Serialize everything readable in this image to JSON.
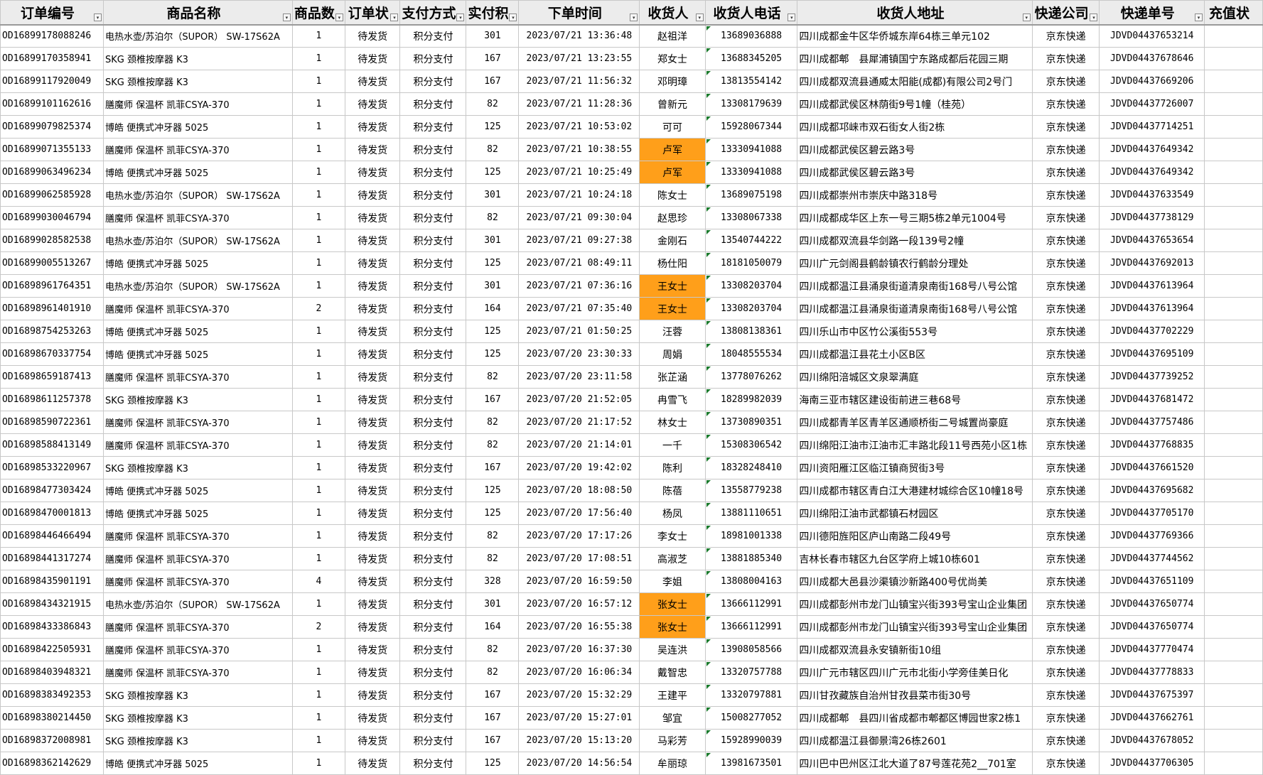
{
  "sheet": {
    "headers": [
      "订单编号",
      "商品名称",
      "商品数",
      "订单状",
      "支付方式",
      "实付积",
      "下单时间",
      "收货人",
      "收货人电话",
      "收货人地址",
      "快递公司",
      "快递单号",
      "充值状"
    ],
    "filter_icon": "▾",
    "highlight_color": "#ff9f1a",
    "rows": [
      {
        "id": "OD16899178088246",
        "name": "电热水壶/苏泊尔（SUPOR） SW-17S62A",
        "qty": "1",
        "status": "待发货",
        "pay": "积分支付",
        "points": "301",
        "time": "2023/07/21 13:36:48",
        "recv": "赵祖洋",
        "phone": "13689036888",
        "addr": "四川成都金牛区华侨城东岸64栋三单元102",
        "co": "京东快递",
        "track": "JDVD04437653214",
        "recharge": "",
        "hl": false
      },
      {
        "id": "OD16899170358941",
        "name": "SKG 颈椎按摩器 K3",
        "qty": "1",
        "status": "待发货",
        "pay": "积分支付",
        "points": "167",
        "time": "2023/07/21 13:23:55",
        "recv": "郑女士",
        "phone": "13688345205",
        "addr": "四川成都郫　县犀浦镇国宁东路成都后花园三期",
        "co": "京东快递",
        "track": "JDVD04437678646",
        "recharge": "",
        "hl": false
      },
      {
        "id": "OD16899117920049",
        "name": "SKG 颈椎按摩器 K3",
        "qty": "1",
        "status": "待发货",
        "pay": "积分支付",
        "points": "167",
        "time": "2023/07/21 11:56:32",
        "recv": "邓明璋",
        "phone": "13813554142",
        "addr": "四川成都双流县通威太阳能(成都)有限公司2号门",
        "co": "京东快递",
        "track": "JDVD04437669206",
        "recharge": "",
        "hl": false
      },
      {
        "id": "OD16899101162616",
        "name": "膳魔师 保温杯 凯菲CSYA-370",
        "qty": "1",
        "status": "待发货",
        "pay": "积分支付",
        "points": "82",
        "time": "2023/07/21 11:28:36",
        "recv": "曾新元",
        "phone": "13308179639",
        "addr": "四川成都武侯区林荫街9号1幢（桂苑）",
        "co": "京东快递",
        "track": "JDVD04437726007",
        "recharge": "",
        "hl": false
      },
      {
        "id": "OD16899079825374",
        "name": "博皓 便携式冲牙器 5025",
        "qty": "1",
        "status": "待发货",
        "pay": "积分支付",
        "points": "125",
        "time": "2023/07/21 10:53:02",
        "recv": "可可",
        "phone": "15928067344",
        "addr": "四川成都邛崃市双石街女人街2栋",
        "co": "京东快递",
        "track": "JDVD04437714251",
        "recharge": "",
        "hl": false
      },
      {
        "id": "OD16899071355133",
        "name": "膳魔师 保温杯 凯菲CSYA-370",
        "qty": "1",
        "status": "待发货",
        "pay": "积分支付",
        "points": "82",
        "time": "2023/07/21 10:38:55",
        "recv": "卢军",
        "phone": "13330941088",
        "addr": "四川成都武侯区碧云路3号",
        "co": "京东快递",
        "track": "JDVD04437649342",
        "recharge": "",
        "hl": true
      },
      {
        "id": "OD16899063496234",
        "name": "博皓 便携式冲牙器 5025",
        "qty": "1",
        "status": "待发货",
        "pay": "积分支付",
        "points": "125",
        "time": "2023/07/21 10:25:49",
        "recv": "卢军",
        "phone": "13330941088",
        "addr": "四川成都武侯区碧云路3号",
        "co": "京东快递",
        "track": "JDVD04437649342",
        "recharge": "",
        "hl": true
      },
      {
        "id": "OD16899062585928",
        "name": "电热水壶/苏泊尔（SUPOR） SW-17S62A",
        "qty": "1",
        "status": "待发货",
        "pay": "积分支付",
        "points": "301",
        "time": "2023/07/21 10:24:18",
        "recv": "陈女士",
        "phone": "13689075198",
        "addr": "四川成都崇州市崇庆中路318号",
        "co": "京东快递",
        "track": "JDVD04437633549",
        "recharge": "",
        "hl": false
      },
      {
        "id": "OD16899030046794",
        "name": "膳魔师 保温杯 凯菲CSYA-370",
        "qty": "1",
        "status": "待发货",
        "pay": "积分支付",
        "points": "82",
        "time": "2023/07/21 09:30:04",
        "recv": "赵思珍",
        "phone": "13308067338",
        "addr": "四川成都成华区上东一号三期5栋2单元1004号",
        "co": "京东快递",
        "track": "JDVD04437738129",
        "recharge": "",
        "hl": false
      },
      {
        "id": "OD16899028582538",
        "name": "电热水壶/苏泊尔（SUPOR） SW-17S62A",
        "qty": "1",
        "status": "待发货",
        "pay": "积分支付",
        "points": "301",
        "time": "2023/07/21 09:27:38",
        "recv": "金刚石",
        "phone": "13540744222",
        "addr": "四川成都双流县华剑路一段139号2幢",
        "co": "京东快递",
        "track": "JDVD04437653654",
        "recharge": "",
        "hl": false
      },
      {
        "id": "OD16899005513267",
        "name": "博皓 便携式冲牙器 5025",
        "qty": "1",
        "status": "待发货",
        "pay": "积分支付",
        "points": "125",
        "time": "2023/07/21 08:49:11",
        "recv": "杨仕阳",
        "phone": "18181050079",
        "addr": "四川广元剑阁县鹤龄镇农行鹤龄分理处",
        "co": "京东快递",
        "track": "JDVD04437692013",
        "recharge": "",
        "hl": false
      },
      {
        "id": "OD16898961764351",
        "name": "电热水壶/苏泊尔（SUPOR） SW-17S62A",
        "qty": "1",
        "status": "待发货",
        "pay": "积分支付",
        "points": "301",
        "time": "2023/07/21 07:36:16",
        "recv": "王女士",
        "phone": "13308203704",
        "addr": "四川成都温江县涌泉街道清泉南街168号八号公馆",
        "co": "京东快递",
        "track": "JDVD04437613964",
        "recharge": "",
        "hl": true
      },
      {
        "id": "OD16898961401910",
        "name": "膳魔师 保温杯 凯菲CSYA-370",
        "qty": "2",
        "status": "待发货",
        "pay": "积分支付",
        "points": "164",
        "time": "2023/07/21 07:35:40",
        "recv": "王女士",
        "phone": "13308203704",
        "addr": "四川成都温江县涌泉街道清泉南街168号八号公馆",
        "co": "京东快递",
        "track": "JDVD04437613964",
        "recharge": "",
        "hl": true
      },
      {
        "id": "OD16898754253263",
        "name": "博皓 便携式冲牙器 5025",
        "qty": "1",
        "status": "待发货",
        "pay": "积分支付",
        "points": "125",
        "time": "2023/07/21 01:50:25",
        "recv": "汪蓉",
        "phone": "13808138361",
        "addr": "四川乐山市中区竹公溪街553号",
        "co": "京东快递",
        "track": "JDVD04437702229",
        "recharge": "",
        "hl": false
      },
      {
        "id": "OD16898670337754",
        "name": "博皓 便携式冲牙器 5025",
        "qty": "1",
        "status": "待发货",
        "pay": "积分支付",
        "points": "125",
        "time": "2023/07/20 23:30:33",
        "recv": "周娟",
        "phone": "18048555534",
        "addr": "四川成都温江县花土小区B区",
        "co": "京东快递",
        "track": "JDVD04437695109",
        "recharge": "",
        "hl": false
      },
      {
        "id": "OD16898659187413",
        "name": "膳魔师 保温杯 凯菲CSYA-370",
        "qty": "1",
        "status": "待发货",
        "pay": "积分支付",
        "points": "82",
        "time": "2023/07/20 23:11:58",
        "recv": "张芷涵",
        "phone": "13778076262",
        "addr": "四川绵阳涪城区文泉翠满庭",
        "co": "京东快递",
        "track": "JDVD04437739252",
        "recharge": "",
        "hl": false
      },
      {
        "id": "OD16898611257378",
        "name": "SKG 颈椎按摩器 K3",
        "qty": "1",
        "status": "待发货",
        "pay": "积分支付",
        "points": "167",
        "time": "2023/07/20 21:52:05",
        "recv": "冉雪飞",
        "phone": "18289982039",
        "addr": "海南三亚市辖区建设街前进三巷68号",
        "co": "京东快递",
        "track": "JDVD04437681472",
        "recharge": "",
        "hl": false
      },
      {
        "id": "OD16898590722361",
        "name": "膳魔师 保温杯 凯菲CSYA-370",
        "qty": "1",
        "status": "待发货",
        "pay": "积分支付",
        "points": "82",
        "time": "2023/07/20 21:17:52",
        "recv": "林女士",
        "phone": "13730890351",
        "addr": "四川成都青羊区青羊区通顺桥街二号城置尚豪庭",
        "co": "京东快递",
        "track": "JDVD04437757486",
        "recharge": "",
        "hl": false
      },
      {
        "id": "OD16898588413149",
        "name": "膳魔师 保温杯 凯菲CSYA-370",
        "qty": "1",
        "status": "待发货",
        "pay": "积分支付",
        "points": "82",
        "time": "2023/07/20 21:14:01",
        "recv": "一千",
        "phone": "15308306542",
        "addr": "四川绵阳江油市江油市汇丰路北段11号西苑小区1栋",
        "co": "京东快递",
        "track": "JDVD04437768835",
        "recharge": "",
        "hl": false
      },
      {
        "id": "OD16898533220967",
        "name": "SKG 颈椎按摩器 K3",
        "qty": "1",
        "status": "待发货",
        "pay": "积分支付",
        "points": "167",
        "time": "2023/07/20 19:42:02",
        "recv": "陈利",
        "phone": "18328248410",
        "addr": "四川资阳雁江区临江镇商贸街3号",
        "co": "京东快递",
        "track": "JDVD04437661520",
        "recharge": "",
        "hl": false
      },
      {
        "id": "OD16898477303424",
        "name": "博皓 便携式冲牙器 5025",
        "qty": "1",
        "status": "待发货",
        "pay": "积分支付",
        "points": "125",
        "time": "2023/07/20 18:08:50",
        "recv": "陈蓓",
        "phone": "13558779238",
        "addr": "四川成都市辖区青白江大港建材城综合区10幢18号",
        "co": "京东快递",
        "track": "JDVD04437695682",
        "recharge": "",
        "hl": false
      },
      {
        "id": "OD16898470001813",
        "name": "博皓 便携式冲牙器 5025",
        "qty": "1",
        "status": "待发货",
        "pay": "积分支付",
        "points": "125",
        "time": "2023/07/20 17:56:40",
        "recv": "杨凤",
        "phone": "13881110651",
        "addr": "四川绵阳江油市武都镇石材园区",
        "co": "京东快递",
        "track": "JDVD04437705170",
        "recharge": "",
        "hl": false
      },
      {
        "id": "OD16898446466494",
        "name": "膳魔师 保温杯 凯菲CSYA-370",
        "qty": "1",
        "status": "待发货",
        "pay": "积分支付",
        "points": "82",
        "time": "2023/07/20 17:17:26",
        "recv": "李女士",
        "phone": "18981001338",
        "addr": "四川德阳旌阳区庐山南路二段49号",
        "co": "京东快递",
        "track": "JDVD04437769366",
        "recharge": "",
        "hl": false
      },
      {
        "id": "OD16898441317274",
        "name": "膳魔师 保温杯 凯菲CSYA-370",
        "qty": "1",
        "status": "待发货",
        "pay": "积分支付",
        "points": "82",
        "time": "2023/07/20 17:08:51",
        "recv": "高淑芝",
        "phone": "13881885340",
        "addr": "吉林长春市辖区九台区学府上城10栋601",
        "co": "京东快递",
        "track": "JDVD04437744562",
        "recharge": "",
        "hl": false
      },
      {
        "id": "OD16898435901191",
        "name": "膳魔师 保温杯 凯菲CSYA-370",
        "qty": "4",
        "status": "待发货",
        "pay": "积分支付",
        "points": "328",
        "time": "2023/07/20 16:59:50",
        "recv": "李姐",
        "phone": "13808004163",
        "addr": "四川成都大邑县沙渠镇沙新路400号优尚美",
        "co": "京东快递",
        "track": "JDVD04437651109",
        "recharge": "",
        "hl": false
      },
      {
        "id": "OD16898434321915",
        "name": "电热水壶/苏泊尔（SUPOR） SW-17S62A",
        "qty": "1",
        "status": "待发货",
        "pay": "积分支付",
        "points": "301",
        "time": "2023/07/20 16:57:12",
        "recv": "张女士",
        "phone": "13666112991",
        "addr": "四川成都彭州市龙门山镇宝兴街393号宝山企业集团",
        "co": "京东快递",
        "track": "JDVD04437650774",
        "recharge": "",
        "hl": true
      },
      {
        "id": "OD16898433386843",
        "name": "膳魔师 保温杯 凯菲CSYA-370",
        "qty": "2",
        "status": "待发货",
        "pay": "积分支付",
        "points": "164",
        "time": "2023/07/20 16:55:38",
        "recv": "张女士",
        "phone": "13666112991",
        "addr": "四川成都彭州市龙门山镇宝兴街393号宝山企业集团",
        "co": "京东快递",
        "track": "JDVD04437650774",
        "recharge": "",
        "hl": true
      },
      {
        "id": "OD16898422505931",
        "name": "膳魔师 保温杯 凯菲CSYA-370",
        "qty": "1",
        "status": "待发货",
        "pay": "积分支付",
        "points": "82",
        "time": "2023/07/20 16:37:30",
        "recv": "吴连洪",
        "phone": "13908058566",
        "addr": "四川成都双流县永安镇新街10组",
        "co": "京东快递",
        "track": "JDVD04437770474",
        "recharge": "",
        "hl": false
      },
      {
        "id": "OD16898403948321",
        "name": "膳魔师 保温杯 凯菲CSYA-370",
        "qty": "1",
        "status": "待发货",
        "pay": "积分支付",
        "points": "82",
        "time": "2023/07/20 16:06:34",
        "recv": "戴智忠",
        "phone": "13320757788",
        "addr": "四川广元市辖区四川广元市北街小学旁佳美日化",
        "co": "京东快递",
        "track": "JDVD04437778833",
        "recharge": "",
        "hl": false
      },
      {
        "id": "OD16898383492353",
        "name": "SKG 颈椎按摩器 K3",
        "qty": "1",
        "status": "待发货",
        "pay": "积分支付",
        "points": "167",
        "time": "2023/07/20 15:32:29",
        "recv": "王建平",
        "phone": "13320797881",
        "addr": "四川甘孜藏族自治州甘孜县菜市街30号",
        "co": "京东快递",
        "track": "JDVD04437675397",
        "recharge": "",
        "hl": false
      },
      {
        "id": "OD16898380214450",
        "name": "SKG 颈椎按摩器 K3",
        "qty": "1",
        "status": "待发货",
        "pay": "积分支付",
        "points": "167",
        "time": "2023/07/20 15:27:01",
        "recv": "邹宜",
        "phone": "15008277052",
        "addr": "四川成都郫　县四川省成都市郫都区博园世家2栋1",
        "co": "京东快递",
        "track": "JDVD04437662761",
        "recharge": "",
        "hl": false
      },
      {
        "id": "OD16898372008981",
        "name": "SKG 颈椎按摩器 K3",
        "qty": "1",
        "status": "待发货",
        "pay": "积分支付",
        "points": "167",
        "time": "2023/07/20 15:13:20",
        "recv": "马彩芳",
        "phone": "15928990039",
        "addr": "四川成都温江县御景湾26栋2601",
        "co": "京东快递",
        "track": "JDVD04437678052",
        "recharge": "",
        "hl": false
      },
      {
        "id": "OD16898362142629",
        "name": "博皓 便携式冲牙器 5025",
        "qty": "1",
        "status": "待发货",
        "pay": "积分支付",
        "points": "125",
        "time": "2023/07/20 14:56:54",
        "recv": "牟丽琼",
        "phone": "13981673501",
        "addr": "四川巴中巴州区江北大道了87号莲花苑2__701室",
        "co": "京东快递",
        "track": "JDVD04437706305",
        "recharge": "",
        "hl": false
      }
    ]
  }
}
